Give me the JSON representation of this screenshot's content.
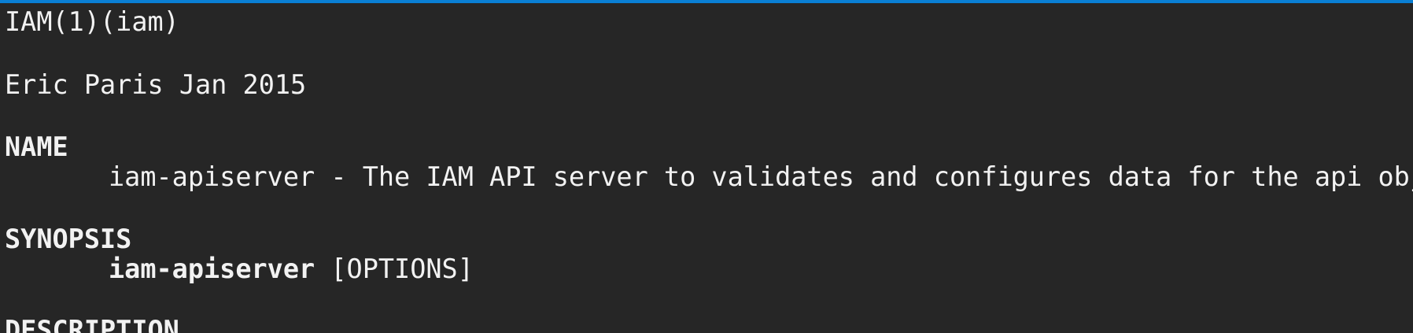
{
  "accent_color": "#0a7fd4",
  "background_color": "#262626",
  "text_color": "#f2f2f2",
  "man_page": {
    "header": "IAM(1)(iam)",
    "author_date": "Eric Paris Jan 2015",
    "sections": {
      "name": {
        "heading": "NAME",
        "text": "iam-apiserver - The IAM API server to validates and configures data for the api objects"
      },
      "synopsis": {
        "heading": "SYNOPSIS",
        "command": "iam-apiserver",
        "args": " [OPTIONS]"
      },
      "description": {
        "heading": "DESCRIPTION"
      }
    }
  }
}
